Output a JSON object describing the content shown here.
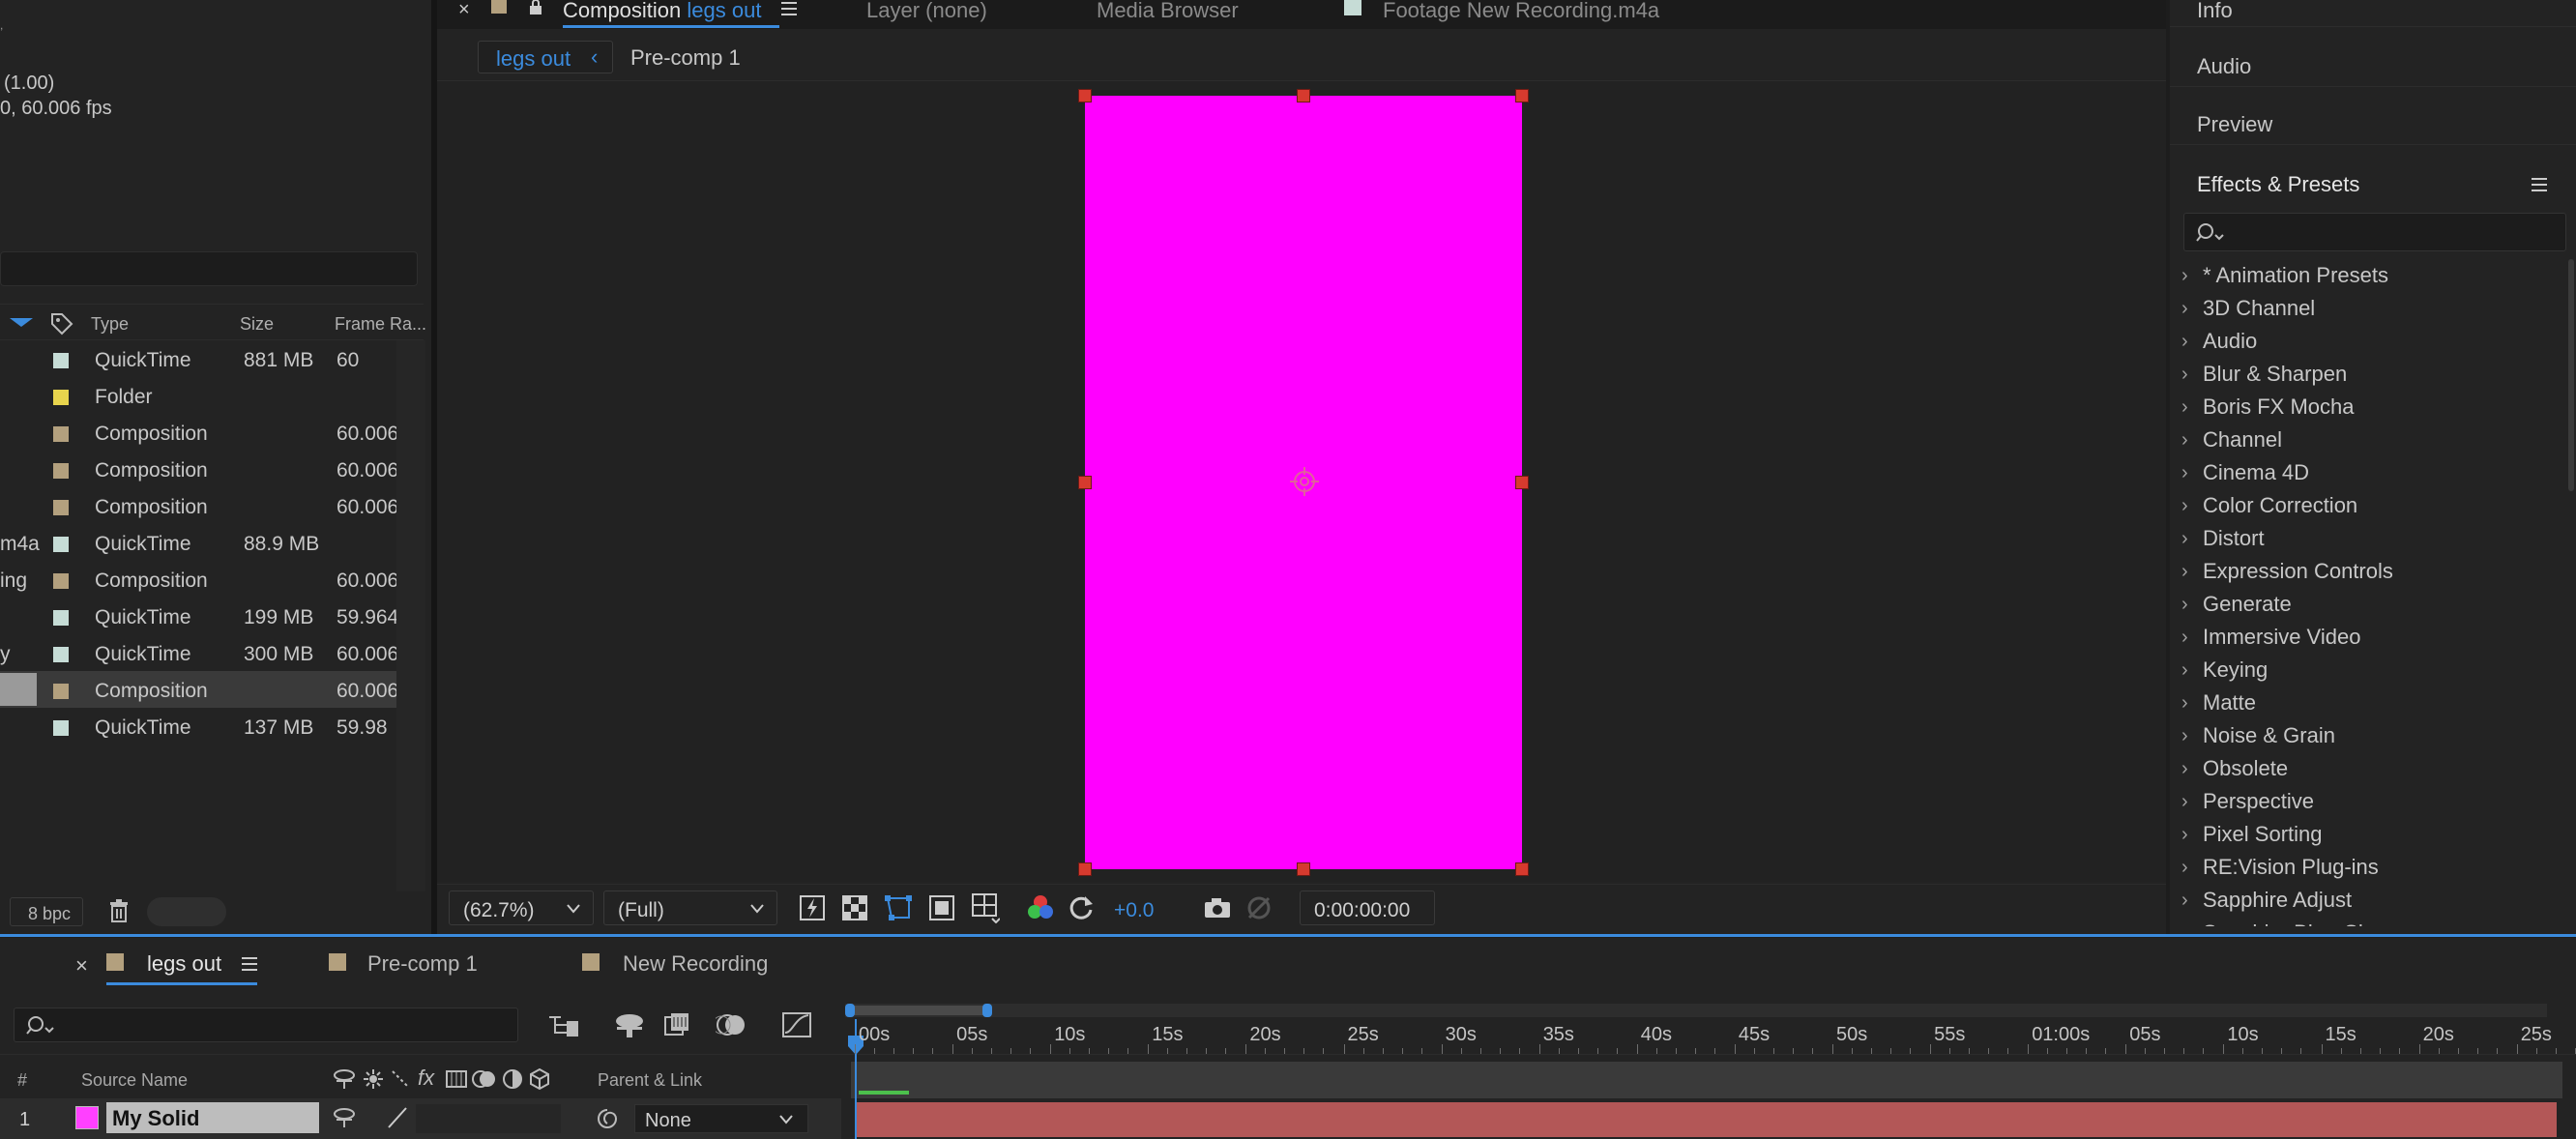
{
  "project": {
    "info_line1": "(1.00)",
    "info_line2": "0, 60.006 fps",
    "columns": {
      "type": "Type",
      "size": "Size",
      "frame_rate": "Frame Ra..."
    },
    "rows": [
      {
        "name": "",
        "color": "#c6dcd6",
        "type": "QuickTime",
        "size": "881 MB",
        "fps": "60"
      },
      {
        "name": "",
        "color": "#e8d44d",
        "type": "Folder",
        "size": "",
        "fps": ""
      },
      {
        "name": "",
        "color": "#b3a07e",
        "type": "Composition",
        "size": "",
        "fps": "60.006"
      },
      {
        "name": "",
        "color": "#b3a07e",
        "type": "Composition",
        "size": "",
        "fps": "60.006"
      },
      {
        "name": "",
        "color": "#b3a07e",
        "type": "Composition",
        "size": "",
        "fps": "60.006"
      },
      {
        "name": "m4a",
        "color": "#c6dcd6",
        "type": "QuickTime",
        "size": "88.9 MB",
        "fps": ""
      },
      {
        "name": "ing",
        "color": "#b3a07e",
        "type": "Composition",
        "size": "",
        "fps": "60.006"
      },
      {
        "name": "",
        "color": "#c6dcd6",
        "type": "QuickTime",
        "size": "199 MB",
        "fps": "59.964"
      },
      {
        "name": "y",
        "color": "#c6dcd6",
        "type": "QuickTime",
        "size": "300 MB",
        "fps": "60.006"
      },
      {
        "name": "",
        "color": "#b3a07e",
        "type": "Composition",
        "size": "",
        "fps": "60.006",
        "selected": true
      },
      {
        "name": "",
        "color": "#c6dcd6",
        "type": "QuickTime",
        "size": "137 MB",
        "fps": "59.98"
      }
    ],
    "bpc": "8 bpc"
  },
  "viewer_tabs": {
    "composition_prefix": "Composition",
    "composition_name": "legs out",
    "layer_prefix": "Layer",
    "layer_value": "(none)",
    "media_browser": "Media Browser",
    "footage_prefix": "Footage",
    "footage_name": "New Recording.m4a"
  },
  "breadcrumb": {
    "current": "legs out",
    "next": "Pre-comp 1"
  },
  "viewer_footer": {
    "zoom": "(62.7%)",
    "resolution": "(Full)",
    "exposure": "+0.0",
    "timecode": "0:00:00:00"
  },
  "comp_colors": {
    "solid": "#ff00ff",
    "handle": "#d63a2e",
    "accent": "#3b8bdd"
  },
  "right_panel": {
    "tabs": [
      "Info",
      "Audio",
      "Preview"
    ],
    "effects_title": "Effects & Presets",
    "effects": [
      "* Animation Presets",
      "3D Channel",
      "Audio",
      "Blur & Sharpen",
      "Boris FX Mocha",
      "Channel",
      "Cinema 4D",
      "Color Correction",
      "Distort",
      "Expression Controls",
      "Generate",
      "Immersive Video",
      "Keying",
      "Matte",
      "Noise & Grain",
      "Obsolete",
      "Perspective",
      "Pixel Sorting",
      "RE:Vision Plug-ins",
      "Sapphire Adjust",
      "Sapphire Blur+Sharpen"
    ]
  },
  "timeline": {
    "tabs": [
      "legs out",
      "Pre-comp 1",
      "New Recording"
    ],
    "ruler": [
      "00s",
      "05s",
      "10s",
      "15s",
      "20s",
      "25s",
      "30s",
      "35s",
      "40s",
      "45s",
      "50s",
      "55s",
      "01:00s",
      "05s",
      "10s",
      "15s",
      "20s",
      "25s"
    ],
    "col_num": "#",
    "col_source": "Source Name",
    "col_parent": "Parent & Link",
    "layer": {
      "num": "1",
      "name": "My Solid",
      "parent": "None",
      "color": "#ff40ff"
    }
  }
}
